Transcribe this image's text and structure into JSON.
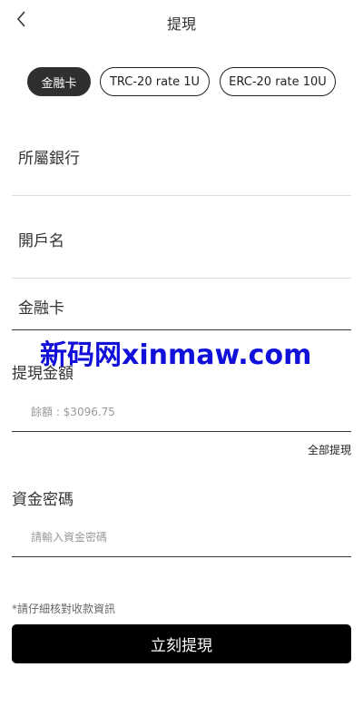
{
  "header": {
    "title": "提現",
    "back_icon": "chevron-left-icon"
  },
  "chips": [
    {
      "label": "金融卡",
      "active": true
    },
    {
      "label": "TRC-20 rate 1U",
      "active": false
    },
    {
      "label": "ERC-20 rate 10U",
      "active": false
    }
  ],
  "fields": {
    "bank_label": "所屬銀行",
    "account_name_label": "開戶名",
    "card_label": "金融卡"
  },
  "amount": {
    "label": "提現金額",
    "placeholder": "餘額 : $3096.75",
    "withdraw_all": "全部提現"
  },
  "password": {
    "label": "資金密碼",
    "placeholder": "請輸入資金密碼"
  },
  "notice": "*請仔細核對收款資訊",
  "submit_label": "立刻提現",
  "watermark": "新码网xinmaw.com",
  "colors": {
    "primary": "#000000",
    "chip_active": "#2f2f2f",
    "watermark": "#1010d8"
  }
}
